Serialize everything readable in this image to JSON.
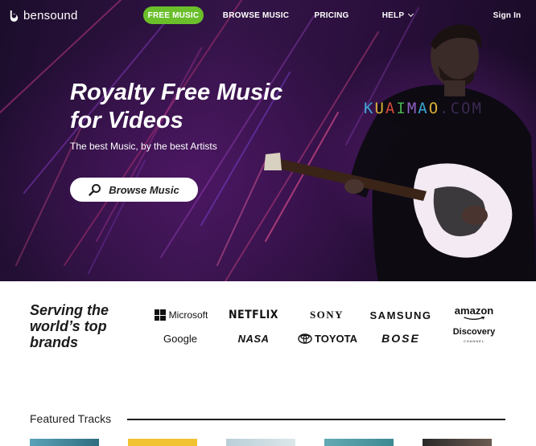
{
  "nav": {
    "logo_text": "bensound",
    "free_music": "FREE MUSIC",
    "browse_music": "BROWSE MUSIC",
    "pricing": "PRICING",
    "help": "HELP",
    "sign_in": "Sign In",
    "accent_color": "#6abf2b"
  },
  "hero": {
    "title_line1": "Royalty Free Music",
    "title_line2": "for Videos",
    "subtitle": "The best Music, by the best Artists",
    "browse_button": "Browse Music",
    "watermark": [
      "K",
      "U",
      "A",
      "I",
      "M",
      "A",
      "O"
    ],
    "watermark_suffix": ".COM"
  },
  "brands": {
    "title_line1": "Serving the",
    "title_line2": "world’s top",
    "title_line3": "brands",
    "logos": {
      "microsoft": "Microsoft",
      "netflix": "NETFLIX",
      "sony": "SONY",
      "samsung": "SAMSUNG",
      "amazon": "amazon",
      "google": "Google",
      "nasa": "NASA",
      "toyota": "TOYOTA",
      "bose": "BOSE",
      "discovery": "Discovery",
      "discovery_sub": "CHANNEL"
    }
  },
  "featured": {
    "title": "Featured Tracks"
  }
}
